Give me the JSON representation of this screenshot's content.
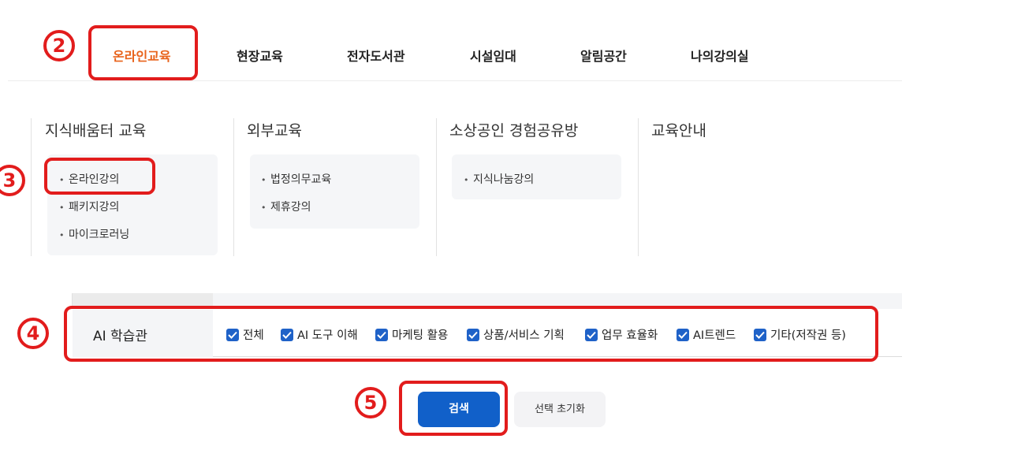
{
  "nav": {
    "items": [
      {
        "label": "온라인교육",
        "active": true
      },
      {
        "label": "현장교육",
        "active": false
      },
      {
        "label": "전자도서관",
        "active": false
      },
      {
        "label": "시설임대",
        "active": false
      },
      {
        "label": "알림공간",
        "active": false
      },
      {
        "label": "나의강의실",
        "active": false
      }
    ]
  },
  "menu": {
    "columns": [
      {
        "title": "지식배움터 교육",
        "items": [
          "온라인강의",
          "패키지강의",
          "마이크로러닝"
        ]
      },
      {
        "title": "외부교육",
        "items": [
          "법정의무교육",
          "제휴강의"
        ]
      },
      {
        "title": "소상공인 경험공유방",
        "items": [
          "지식나눔강의"
        ]
      },
      {
        "title": "교육안내",
        "items": []
      }
    ]
  },
  "filter": {
    "label": "AI 학습관",
    "options": [
      {
        "label": "전체",
        "checked": true
      },
      {
        "label": "AI 도구 이해",
        "checked": true
      },
      {
        "label": "마케팅 활용",
        "checked": true
      },
      {
        "label": "상품/서비스 기획",
        "checked": true
      },
      {
        "label": "업무 효율화",
        "checked": true
      },
      {
        "label": "AI트렌드",
        "checked": true
      },
      {
        "label": "기타(저작권 등)",
        "checked": true
      }
    ]
  },
  "buttons": {
    "search": "검색",
    "reset": "선택 초기화"
  },
  "callouts": {
    "c2": "2",
    "c3": "3",
    "c4": "4",
    "c5": "5"
  },
  "colors": {
    "accent": "#e8621a",
    "primary": "#1160c9",
    "highlight": "#e21c1c",
    "checkbox": "#1f62c8"
  }
}
